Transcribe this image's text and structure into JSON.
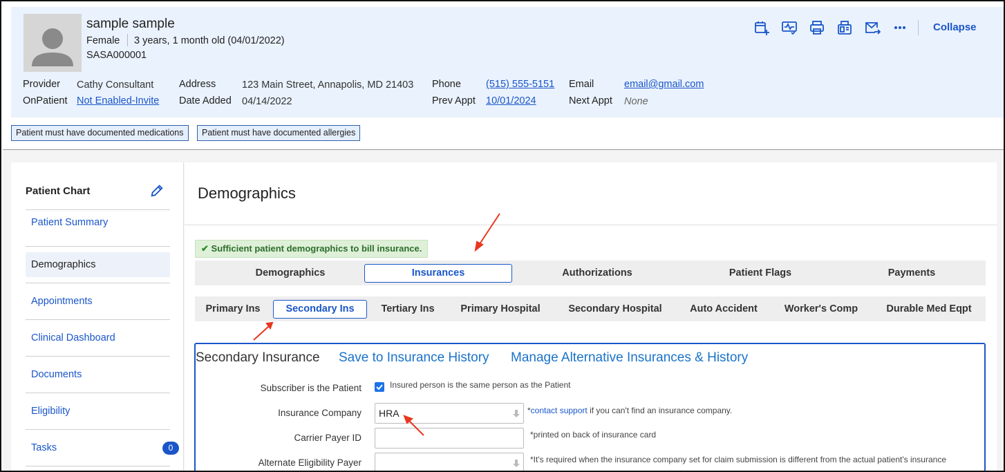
{
  "patient": {
    "name": "sample sample",
    "sex": "Female",
    "age": "3 years, 1 month old (04/01/2022)",
    "id": "SASA000001"
  },
  "details": {
    "provider_label": "Provider",
    "provider": "Cathy Consultant",
    "onpatient_label": "OnPatient",
    "onpatient": "Not Enabled-Invite",
    "address_label": "Address",
    "address": "123 Main Street, Annapolis, MD 21403",
    "date_added_label": "Date Added",
    "date_added": "04/14/2022",
    "phone_label": "Phone",
    "phone": "(515) 555-5151",
    "prev_appt_label": "Prev Appt",
    "prev_appt": "10/01/2024",
    "email_label": "Email",
    "email": "email@gmail.com",
    "next_appt_label": "Next Appt",
    "next_appt": "None"
  },
  "toolbar": {
    "collapse_label": "Collapse",
    "icons": [
      "calendar-add-icon",
      "vitals-icon",
      "print-icon",
      "fax-icon",
      "send-mail-icon",
      "more-icon"
    ]
  },
  "alerts": [
    "Patient must have documented medications",
    "Patient must have documented allergies"
  ],
  "sidebar": {
    "title": "Patient Chart",
    "items": [
      {
        "label": "Patient Summary"
      },
      {
        "label": "Demographics"
      },
      {
        "label": "Appointments"
      },
      {
        "label": "Clinical Dashboard"
      },
      {
        "label": "Documents"
      },
      {
        "label": "Eligibility"
      },
      {
        "label": "Tasks",
        "badge": "0"
      }
    ]
  },
  "main": {
    "title": "Demographics",
    "banner": "Sufficient patient demographics to bill insurance.",
    "tabs": [
      "Demographics",
      "Insurances",
      "Authorizations",
      "Patient Flags",
      "Payments"
    ],
    "active_tab": "Insurances",
    "subtabs": [
      "Primary Ins",
      "Secondary Ins",
      "Tertiary Ins",
      "Primary Hospital",
      "Secondary Hospital",
      "Auto Accident",
      "Worker's Comp",
      "Durable Med Eqpt"
    ],
    "active_subtab": "Secondary Ins"
  },
  "insurance": {
    "title": "Secondary Insurance",
    "save_link": "Save to Insurance History",
    "manage_link": "Manage Alternative Insurances & History",
    "subscriber_label": "Subscriber is the Patient",
    "subscriber_note": "Insured person is the same person as the Patient",
    "subscriber_checked": true,
    "company_label": "Insurance Company",
    "company_value": "HRA",
    "company_note_prefix": "*",
    "company_note_link": "contact support",
    "company_note_suffix": " if you can't find an insurance company.",
    "carrier_label": "Carrier Payer ID",
    "carrier_value": "",
    "carrier_note": "*printed on back of insurance card",
    "alt_payer_label": "Alternate Eligibility Payer",
    "alt_payer_value": "",
    "alt_payer_note": "*It's required when the insurance company set for claim submission is different from the actual patient's insurance"
  },
  "colors": {
    "accent": "#1a56c9",
    "header_bg": "#eaf2fd",
    "success_bg": "#dff0d8",
    "annotation": "#e8361f"
  }
}
